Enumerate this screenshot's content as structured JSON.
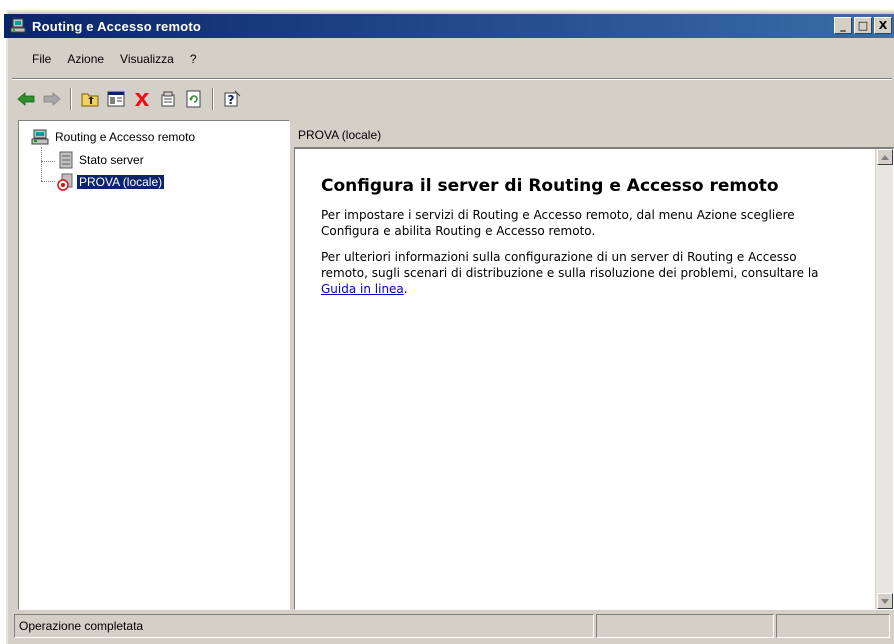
{
  "window": {
    "title": "Routing e Accesso remoto",
    "buttons": {
      "minimize": "_",
      "maximize": "□",
      "close": "X"
    }
  },
  "menu": [
    {
      "label": "File"
    },
    {
      "label": "Azione"
    },
    {
      "label": "Visualizza"
    },
    {
      "label": "?"
    }
  ],
  "toolbar": {
    "icons": [
      "back-arrow-icon",
      "forward-arrow-icon",
      "up-folder-icon",
      "show-hide-tree-icon",
      "delete-icon",
      "properties-icon",
      "refresh-icon",
      "help-icon"
    ]
  },
  "tree": {
    "root": "Routing e Accesso remoto",
    "children": [
      {
        "label": "Stato server"
      },
      {
        "label": "PROVA (locale)",
        "selected": true
      }
    ]
  },
  "right_pane": {
    "header": "PROVA (locale)",
    "heading": "Configura il server di Routing e Accesso remoto",
    "paragraph1": "Per impostare i servizi di Routing e Accesso remoto, dal menu Azione scegliere Configura e abilita Routing e Accesso remoto.",
    "paragraph2_before": "Per ulteriori informazioni sulla configurazione di un server di Routing e Accesso remoto, sugli scenari di distribuzione e sulla risoluzione dei problemi, consultare la ",
    "paragraph2_link": "Guida in linea",
    "paragraph2_after": "."
  },
  "status": {
    "text": "Operazione completata"
  },
  "colors": {
    "titlebar_start": "#0a246a",
    "titlebar_end": "#3a6ea5",
    "face": "#d4d0c8",
    "selection": "#0a246a",
    "link": "#0000cc",
    "delete_red": "#e81010"
  }
}
